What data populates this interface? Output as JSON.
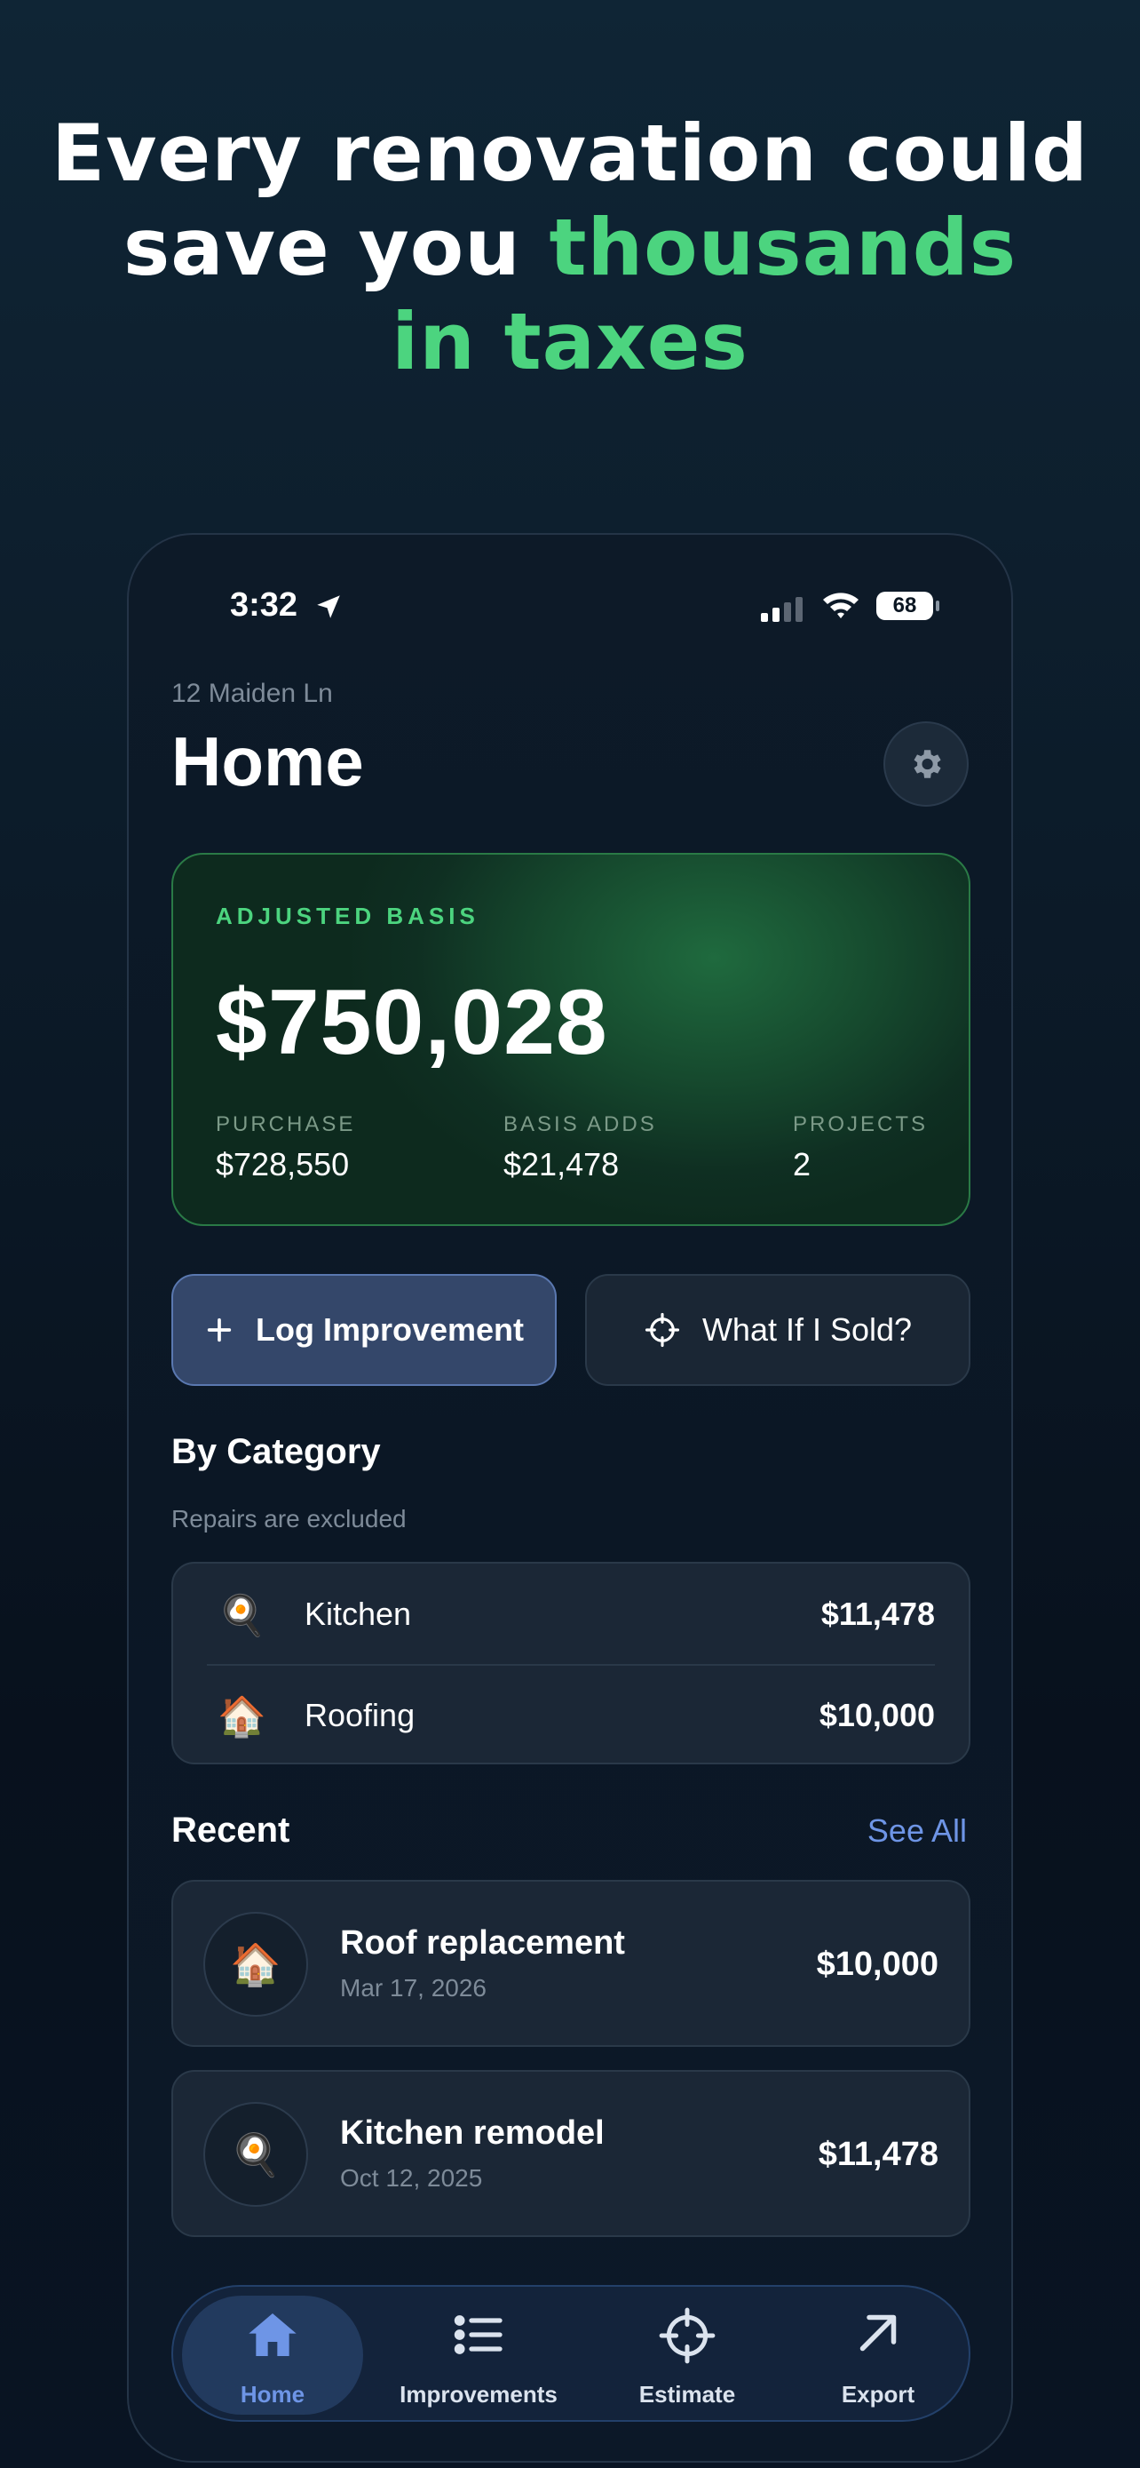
{
  "headline": {
    "line1": "Every renovation could",
    "line2_prefix": "save you ",
    "line2_accent": "thousands",
    "line3_accent": "in taxes"
  },
  "status_bar": {
    "time": "3:32",
    "battery": "68"
  },
  "header": {
    "address": "12 Maiden Ln",
    "title": "Home"
  },
  "basis_card": {
    "label": "ADJUSTED BASIS",
    "amount": "$750,028",
    "stats": [
      {
        "label": "PURCHASE",
        "value": "$728,550"
      },
      {
        "label": "BASIS ADDS",
        "value": "$21,478"
      },
      {
        "label": "PROJECTS",
        "value": "2"
      }
    ]
  },
  "actions": {
    "log_label": "Log Improvement",
    "sold_label": "What If I Sold?"
  },
  "by_category": {
    "title": "By Category",
    "subtitle": "Repairs are excluded",
    "items": [
      {
        "emoji": "🍳",
        "name": "Kitchen",
        "amount": "$11,478"
      },
      {
        "emoji": "🏠",
        "name": "Roofing",
        "amount": "$10,000"
      }
    ]
  },
  "recent": {
    "title": "Recent",
    "see_all": "See All",
    "items": [
      {
        "emoji": "🏠",
        "title": "Roof replacement",
        "date": "Mar 17, 2026",
        "amount": "$10,000"
      },
      {
        "emoji": "🍳",
        "title": "Kitchen remodel",
        "date": "Oct 12, 2025",
        "amount": "$11,478"
      }
    ]
  },
  "tabs": [
    {
      "label": "Home",
      "icon": "house-icon",
      "active": true
    },
    {
      "label": "Improvements",
      "icon": "list-icon"
    },
    {
      "label": "Estimate",
      "icon": "crosshair-icon"
    },
    {
      "label": "Export",
      "icon": "arrow-up-right-icon"
    }
  ],
  "colors": {
    "accent_green": "#4cd47f",
    "accent_blue": "#6e95e6"
  }
}
